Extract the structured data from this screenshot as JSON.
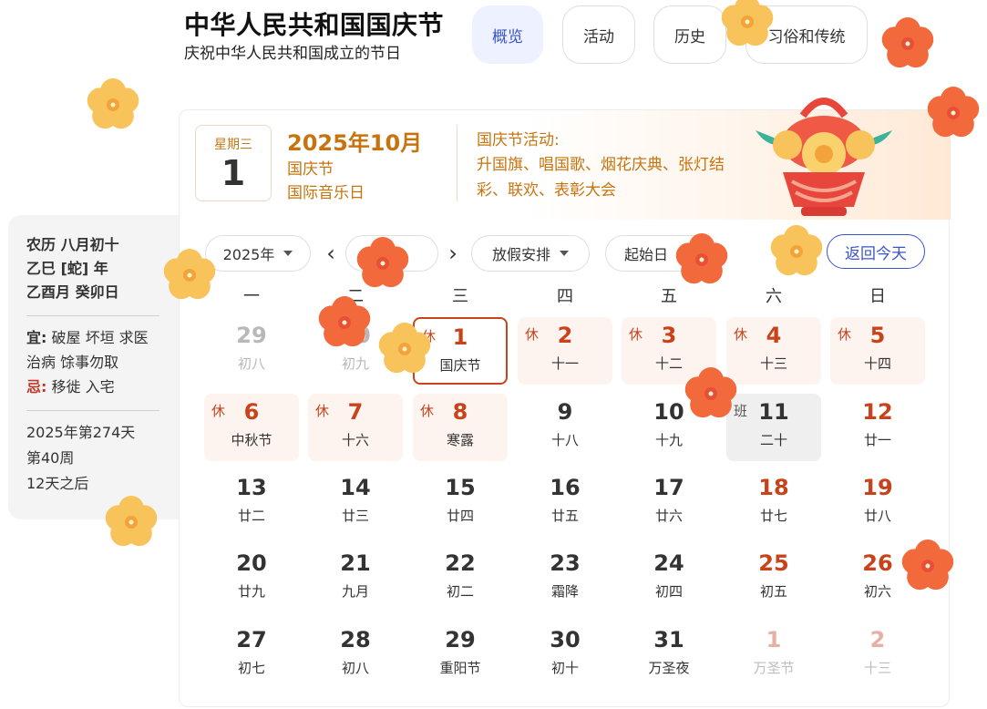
{
  "page": {
    "title": "中华人民共和国国庆节",
    "subtitle": "庆祝中华人民共和国成立的节日"
  },
  "tabs": [
    {
      "label": "概览",
      "active": true
    },
    {
      "label": "活动",
      "active": false
    },
    {
      "label": "历史",
      "active": false
    },
    {
      "label": "习俗和传统",
      "active": false
    }
  ],
  "left_panel": {
    "lunar": [
      "农历 八月初十",
      "乙巳 [蛇] 年",
      "乙酉月 癸卯日"
    ],
    "yi_label": "宜:",
    "yi_text": "破屋 坏垣 求医 治病 馀事勿取",
    "ji_label": "忌:",
    "ji_text": "移徙 入宅",
    "day_of_year": "2025年第274天",
    "week_no": "第40周",
    "countdown": "12天之后"
  },
  "header": {
    "weekday": "星期三",
    "day": "1",
    "month_title": "2025年10月",
    "holiday_1": "国庆节",
    "holiday_2": "国际音乐日",
    "activity_title": "国庆节活动:",
    "activity_text": "升国旗、唱国歌、烟花庆典、张灯结彩、联欢、表彰大会"
  },
  "controls": {
    "year_select": "2025年",
    "month_select": "",
    "holiday_select": "放假安排",
    "start_day": "起始日",
    "prev_arrow": "‹",
    "next_arrow": "›",
    "today_button": "返回今天"
  },
  "weekdays": [
    "一",
    "二",
    "三",
    "四",
    "五",
    "六",
    "日"
  ],
  "calendar_rows": [
    [
      {
        "num": "29",
        "sub": "初八",
        "style": "grey",
        "tag": ""
      },
      {
        "num": "30",
        "sub": "初九",
        "style": "grey",
        "tag": ""
      },
      {
        "num": "1",
        "sub": "国庆节",
        "style": "selected",
        "tag": "休"
      },
      {
        "num": "2",
        "sub": "十一",
        "style": "rest",
        "tag": "休"
      },
      {
        "num": "3",
        "sub": "十二",
        "style": "rest",
        "tag": "休"
      },
      {
        "num": "4",
        "sub": "十三",
        "style": "rest",
        "tag": "休"
      },
      {
        "num": "5",
        "sub": "十四",
        "style": "rest",
        "tag": "休"
      }
    ],
    [
      {
        "num": "6",
        "sub": "中秋节",
        "style": "rest",
        "tag": "休"
      },
      {
        "num": "7",
        "sub": "十六",
        "style": "rest",
        "tag": "休"
      },
      {
        "num": "8",
        "sub": "寒露",
        "style": "rest",
        "tag": "休"
      },
      {
        "num": "9",
        "sub": "十八",
        "style": "normal",
        "tag": ""
      },
      {
        "num": "10",
        "sub": "十九",
        "style": "normal",
        "tag": ""
      },
      {
        "num": "11",
        "sub": "二十",
        "style": "workday",
        "tag": "班"
      },
      {
        "num": "12",
        "sub": "廿一",
        "style": "weekend",
        "tag": ""
      }
    ],
    [
      {
        "num": "13",
        "sub": "廿二",
        "style": "normal",
        "tag": ""
      },
      {
        "num": "14",
        "sub": "廿三",
        "style": "normal",
        "tag": ""
      },
      {
        "num": "15",
        "sub": "廿四",
        "style": "normal",
        "tag": ""
      },
      {
        "num": "16",
        "sub": "廿五",
        "style": "normal",
        "tag": ""
      },
      {
        "num": "17",
        "sub": "廿六",
        "style": "normal",
        "tag": ""
      },
      {
        "num": "18",
        "sub": "廿七",
        "style": "weekend",
        "tag": ""
      },
      {
        "num": "19",
        "sub": "廿八",
        "style": "weekend",
        "tag": ""
      }
    ],
    [
      {
        "num": "20",
        "sub": "廿九",
        "style": "normal",
        "tag": ""
      },
      {
        "num": "21",
        "sub": "九月",
        "style": "normal",
        "tag": ""
      },
      {
        "num": "22",
        "sub": "初二",
        "style": "normal",
        "tag": ""
      },
      {
        "num": "23",
        "sub": "霜降",
        "style": "normal",
        "tag": ""
      },
      {
        "num": "24",
        "sub": "初四",
        "style": "normal",
        "tag": ""
      },
      {
        "num": "25",
        "sub": "初五",
        "style": "weekend",
        "tag": ""
      },
      {
        "num": "26",
        "sub": "初六",
        "style": "weekend",
        "tag": ""
      }
    ],
    [
      {
        "num": "27",
        "sub": "初七",
        "style": "normal",
        "tag": ""
      },
      {
        "num": "28",
        "sub": "初八",
        "style": "normal",
        "tag": ""
      },
      {
        "num": "29",
        "sub": "重阳节",
        "style": "normal",
        "tag": ""
      },
      {
        "num": "30",
        "sub": "初十",
        "style": "normal",
        "tag": ""
      },
      {
        "num": "31",
        "sub": "万圣夜",
        "style": "normal",
        "tag": ""
      },
      {
        "num": "1",
        "sub": "万圣节",
        "style": "pale",
        "tag": ""
      },
      {
        "num": "2",
        "sub": "十三",
        "style": "pale",
        "tag": ""
      }
    ]
  ],
  "icons": {
    "flower": "plum-blossom-icon",
    "basket": "flower-basket-icon",
    "dropdown": "chevron-down-icon"
  },
  "colors": {
    "accent": "#3a55c8",
    "holiday_red": "#c8431c",
    "gold": "#c7740e",
    "rest_bg": "#fdf4ef",
    "workday_bg": "#efefef",
    "flower_orange": "#f26a3c",
    "flower_yellow": "#f7c35a"
  }
}
